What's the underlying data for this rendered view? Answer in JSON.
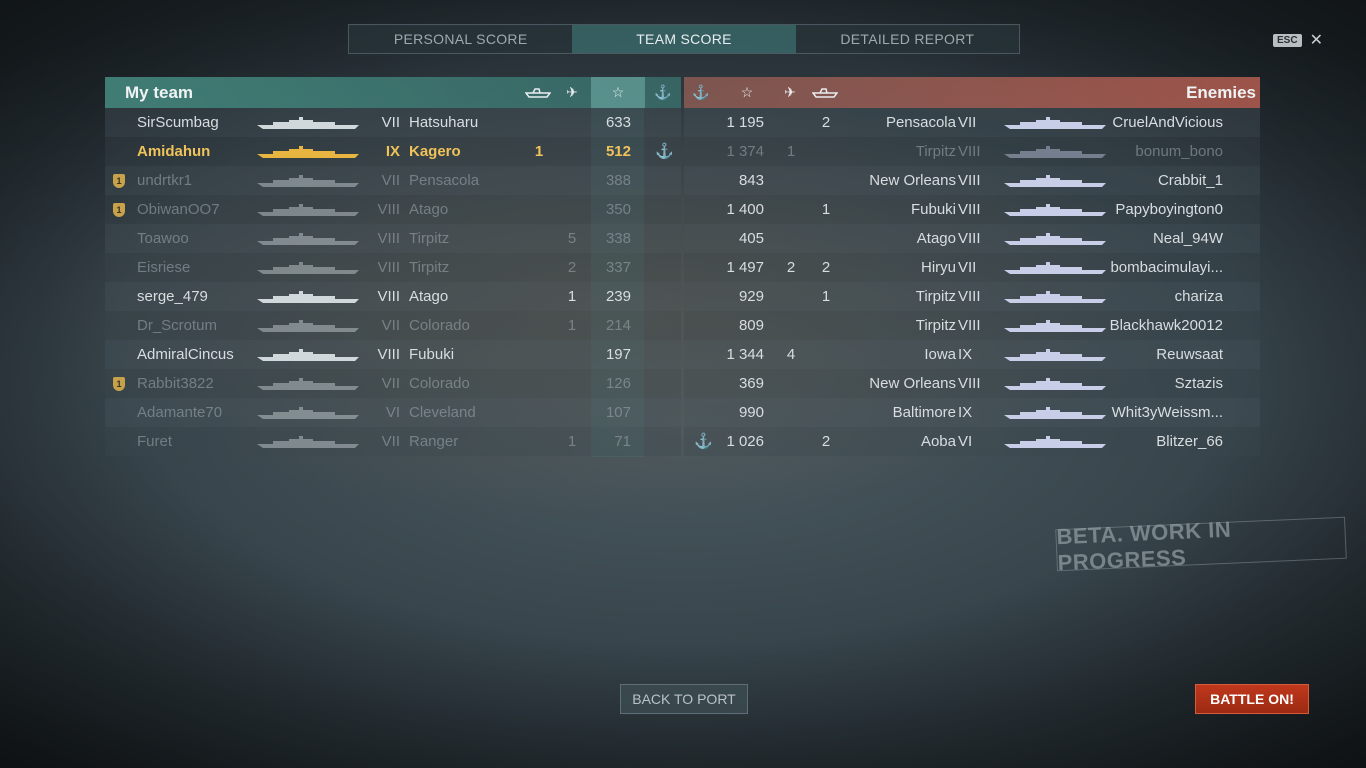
{
  "tabs": [
    {
      "label": "PERSONAL SCORE",
      "active": false
    },
    {
      "label": "TEAM SCORE",
      "active": true
    },
    {
      "label": "DETAILED REPORT",
      "active": false
    }
  ],
  "esc_key": "ESC",
  "my_team": {
    "title": "My team",
    "rows": [
      {
        "player": "SirScumbag",
        "tier": "VII",
        "ship": "Hatsuharu",
        "kills": "",
        "planes": "",
        "score": "633",
        "anchor": false,
        "badge": false,
        "state": "alive"
      },
      {
        "player": "Amidahun",
        "tier": "IX",
        "ship": "Kagero",
        "kills": "1",
        "planes": "",
        "score": "512",
        "anchor": true,
        "badge": false,
        "state": "me"
      },
      {
        "player": "undrtkr1",
        "tier": "VII",
        "ship": "Pensacola",
        "kills": "",
        "planes": "",
        "score": "388",
        "anchor": false,
        "badge": true,
        "state": "dead"
      },
      {
        "player": "ObiwanOO7",
        "tier": "VIII",
        "ship": "Atago",
        "kills": "",
        "planes": "",
        "score": "350",
        "anchor": false,
        "badge": true,
        "state": "dead"
      },
      {
        "player": "Toawoo",
        "tier": "VIII",
        "ship": "Tirpitz",
        "kills": "",
        "planes": "5",
        "score": "338",
        "anchor": false,
        "badge": false,
        "state": "dead"
      },
      {
        "player": "Eisriese",
        "tier": "VIII",
        "ship": "Tirpitz",
        "kills": "",
        "planes": "2",
        "score": "337",
        "anchor": false,
        "badge": false,
        "state": "dead"
      },
      {
        "player": "serge_479",
        "tier": "VIII",
        "ship": "Atago",
        "kills": "",
        "planes": "1",
        "score": "239",
        "anchor": false,
        "badge": false,
        "state": "alive"
      },
      {
        "player": "Dr_Scrotum",
        "tier": "VII",
        "ship": "Colorado",
        "kills": "",
        "planes": "1",
        "score": "214",
        "anchor": false,
        "badge": false,
        "state": "dead"
      },
      {
        "player": "AdmiralCincus",
        "tier": "VIII",
        "ship": "Fubuki",
        "kills": "",
        "planes": "",
        "score": "197",
        "anchor": false,
        "badge": false,
        "state": "alive"
      },
      {
        "player": "Rabbit3822",
        "tier": "VII",
        "ship": "Colorado",
        "kills": "",
        "planes": "",
        "score": "126",
        "anchor": false,
        "badge": true,
        "state": "dead"
      },
      {
        "player": "Adamante70",
        "tier": "VI",
        "ship": "Cleveland",
        "kills": "",
        "planes": "",
        "score": "107",
        "anchor": false,
        "badge": false,
        "state": "dead"
      },
      {
        "player": "Furet",
        "tier": "VII",
        "ship": "Ranger",
        "kills": "",
        "planes": "1",
        "score": "71",
        "anchor": false,
        "badge": false,
        "state": "dead"
      }
    ]
  },
  "enemies": {
    "title": "Enemies",
    "rows": [
      {
        "player": "CruelAndVicious",
        "tier": "VII",
        "ship": "Pensacola",
        "score": "1 195",
        "planes": "",
        "kills": "2",
        "anchor": false,
        "state": "alive"
      },
      {
        "player": "bonum_bono",
        "tier": "VIII",
        "ship": "Tirpitz",
        "score": "1 374",
        "planes": "1",
        "kills": "",
        "anchor": false,
        "state": "dead"
      },
      {
        "player": "Crabbit_1",
        "tier": "VIII",
        "ship": "New Orleans",
        "score": "843",
        "planes": "",
        "kills": "",
        "anchor": false,
        "state": "alive"
      },
      {
        "player": "Papyboyington0",
        "tier": "VIII",
        "ship": "Fubuki",
        "score": "1 400",
        "planes": "",
        "kills": "1",
        "anchor": false,
        "state": "alive"
      },
      {
        "player": "Neal_94W",
        "tier": "VIII",
        "ship": "Atago",
        "score": "405",
        "planes": "",
        "kills": "",
        "anchor": false,
        "state": "alive"
      },
      {
        "player": "bombacimulayi...",
        "tier": "VII",
        "ship": "Hiryu",
        "score": "1 497",
        "planes": "2",
        "kills": "2",
        "anchor": false,
        "state": "alive"
      },
      {
        "player": "chariza",
        "tier": "VIII",
        "ship": "Tirpitz",
        "score": "929",
        "planes": "",
        "kills": "1",
        "anchor": false,
        "state": "alive"
      },
      {
        "player": "Blackhawk20012",
        "tier": "VIII",
        "ship": "Tirpitz",
        "score": "809",
        "planes": "",
        "kills": "",
        "anchor": false,
        "state": "alive"
      },
      {
        "player": "Reuwsaat",
        "tier": "IX",
        "ship": "Iowa",
        "score": "1 344",
        "planes": "4",
        "kills": "",
        "anchor": false,
        "state": "alive"
      },
      {
        "player": "Sztazis",
        "tier": "VIII",
        "ship": "New Orleans",
        "score": "369",
        "planes": "",
        "kills": "",
        "anchor": false,
        "state": "alive"
      },
      {
        "player": "Whit3yWeissm...",
        "tier": "IX",
        "ship": "Baltimore",
        "score": "990",
        "planes": "",
        "kills": "",
        "anchor": false,
        "state": "alive"
      },
      {
        "player": "Blitzer_66",
        "tier": "VI",
        "ship": "Aoba",
        "score": "1 026",
        "planes": "",
        "kills": "2",
        "anchor": true,
        "state": "alive"
      }
    ]
  },
  "beta_stamp": "BETA. WORK IN PROGRESS",
  "buttons": {
    "back": "BACK TO PORT",
    "battle": "BATTLE ON!"
  },
  "colors": {
    "accent_team": "#468c82",
    "accent_enemy": "#c86455",
    "highlight_me": "#f0c25a",
    "battle_button": "#b33218"
  }
}
